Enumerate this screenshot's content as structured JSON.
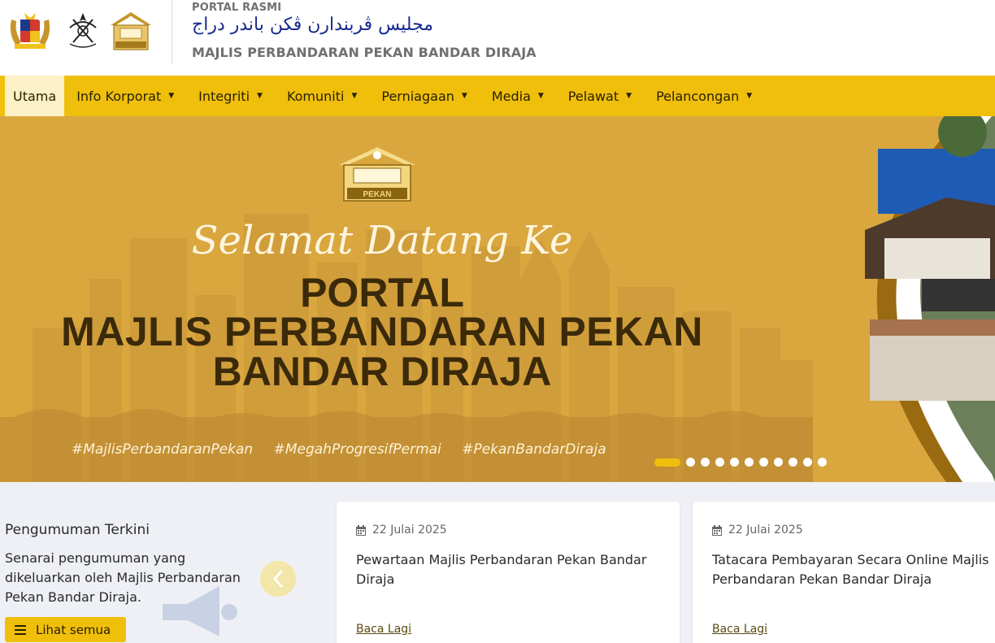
{
  "header": {
    "portal_label": "PORTAL RASMI",
    "jawi_name": "مجليس ڤربندارن ڤکن باندر دراج",
    "site_name": "MAJLIS PERBANDARAN PEKAN BANDAR DIRAJA",
    "logos": [
      "malaysia-coat-of-arms-logo",
      "pahang-crest-logo",
      "mppbd-logo"
    ]
  },
  "nav": {
    "items": [
      {
        "label": "Utama",
        "active": true,
        "has_dropdown": false
      },
      {
        "label": "Info Korporat",
        "active": false,
        "has_dropdown": true
      },
      {
        "label": "Integriti",
        "active": false,
        "has_dropdown": true
      },
      {
        "label": "Komuniti",
        "active": false,
        "has_dropdown": true
      },
      {
        "label": "Perniagaan",
        "active": false,
        "has_dropdown": true
      },
      {
        "label": "Media",
        "active": false,
        "has_dropdown": true
      },
      {
        "label": "Pelawat",
        "active": false,
        "has_dropdown": true
      },
      {
        "label": "Pelancongan",
        "active": false,
        "has_dropdown": true
      }
    ],
    "caret": "▼"
  },
  "hero": {
    "logo_text": "PEKAN",
    "welcome": "Selamat Datang Ke",
    "line1": "PORTAL",
    "line2": "MAJLIS PERBANDARAN PEKAN",
    "line3": "BANDAR DIRAJA",
    "hashtags": [
      "#MajlisPerbandaranPekan",
      "#MegahProgresifPermai",
      "#PekanBandarDiraja"
    ],
    "slide_count": 11,
    "active_slide": 1
  },
  "announcements": {
    "title": "Pengumuman Terkini",
    "description": "Senarai pengumuman yang dikeluarkan oleh Majlis Perbandaran Pekan Bandar Diraja.",
    "view_all": "Lihat semua",
    "cards": [
      {
        "date": "22 Julai 2025",
        "title": "Pewartaan Majlis Perbandaran Pekan Bandar Diraja",
        "link": "Baca Lagi"
      },
      {
        "date": "22 Julai 2025",
        "title": "Tatacara Pembayaran Secara Online Majlis Perbandaran Pekan Bandar Diraja",
        "link": "Baca Lagi"
      }
    ]
  },
  "colors": {
    "accent": "#f0bf0c",
    "hero_bg": "#d9a73e",
    "headline": "#3b2a0a",
    "page_bg": "#eef0f5"
  }
}
